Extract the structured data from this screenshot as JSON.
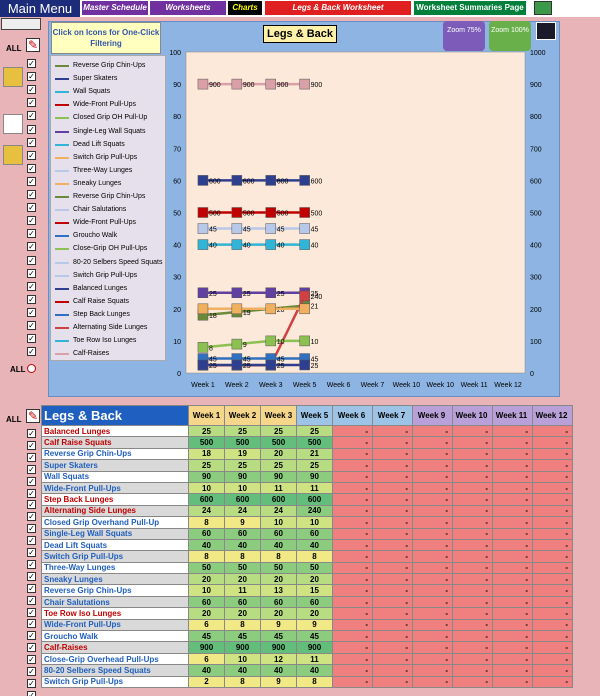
{
  "nav": {
    "main_menu": "Main Menu",
    "master_schedule": "Master Schedule",
    "worksheets": "Worksheets",
    "charts": "Charts",
    "legs_back_worksheet": "Legs & Back Worksheet",
    "worksheet_summaries": "Worksheet Summaries Page"
  },
  "side": {
    "all_top": "ALL",
    "all_bottom": "ALL",
    "all_table": "ALL"
  },
  "chart_panel": {
    "tip": "Click on Icons  for One-Click Filtering",
    "zoom75": "Zoom 75%",
    "zoom100": "Zoom 100%"
  },
  "chart_data": {
    "type": "line",
    "title": "Legs & Back",
    "categories": [
      "Week 1",
      "Week 2",
      "Week 3",
      "Week 5",
      "Week 6",
      "Week 7",
      "Week 10",
      "Week 10",
      "Week 11",
      "Week 12"
    ],
    "ylim": [
      0,
      100
    ],
    "y_ticks": [
      "0",
      "10",
      "20",
      "30",
      "40",
      "50",
      "60",
      "70",
      "80",
      "90",
      "100"
    ],
    "y2_ticks": [
      "0",
      "100",
      "200",
      "300",
      "400",
      "500",
      "600",
      "700",
      "800",
      "900",
      "1000"
    ],
    "legend": [
      "Reverse Grip Chin-Ups",
      "Super Skaters",
      "Wall Squats",
      "Wide-Front Pull-Ups",
      "Closed Grip OH Pull-Up",
      "Single-Leg Wall Squats",
      "Dead Lift Squats",
      "Switch Grip Pull-Ups",
      "Three-Way Lunges",
      "Sneaky Lunges",
      "Reverse Grip Chin-Ups",
      "Chair Salutations",
      "Wide-Front Pull-Ups",
      "Groucho Walk",
      "Close-Grip OH Pull-Ups",
      "80-20 Selbers Speed Squats",
      "Switch Grip Pull-Ups",
      "Balanced Lunges",
      "Calf Raise Squats",
      "Step Back Lunges",
      "Alternating Side Lunges",
      "Toe Row Iso Lunges",
      "Calf-Raises"
    ],
    "series": [
      {
        "name": "Calf-Raises",
        "values": [
          900,
          900,
          900,
          900
        ],
        "axis": "right",
        "color": "#d9a0a8",
        "labels": [
          "900",
          "900",
          "900",
          "900"
        ]
      },
      {
        "name": "Dead Lift Squats",
        "values": [
          600,
          600,
          600,
          600
        ],
        "axis": "right",
        "color": "#2e3f8f",
        "labels": [
          "600",
          "600",
          "600",
          "600"
        ]
      },
      {
        "name": "Calf Raise Squats",
        "values": [
          500,
          500,
          500,
          500
        ],
        "axis": "right",
        "color": "#c00000",
        "labels": [
          "500",
          "500",
          "500",
          "500"
        ]
      },
      {
        "name": "Three-Way Lunges",
        "values": [
          45,
          45,
          45,
          45
        ],
        "axis": "left",
        "color": "#b8c8e8",
        "labels": [
          "45",
          "45",
          "45",
          "45"
        ]
      },
      {
        "name": "Wall Squats",
        "values": [
          40,
          40,
          40,
          40
        ],
        "axis": "left",
        "color": "#31b4d6",
        "labels": [
          "40",
          "40",
          "40",
          "40"
        ]
      },
      {
        "name": "Single-Leg Wall Squats",
        "values": [
          25,
          25,
          25,
          25
        ],
        "axis": "left",
        "color": "#6040a0",
        "labels": [
          "25",
          "25",
          "25",
          "25"
        ]
      },
      {
        "name": "Reverse Grip Chin-Ups",
        "values": [
          18,
          19,
          20,
          21
        ],
        "axis": "left",
        "color": "#6a8a3a",
        "labels": [
          "18",
          "19",
          "20",
          "21"
        ]
      },
      {
        "name": "Alternating Side Lunges",
        "values": [
          2.4,
          2.4,
          2.4,
          24
        ],
        "axis": "left",
        "color": "#d04040",
        "labels": [
          "",
          "",
          "",
          "240"
        ]
      },
      {
        "name": "Groucho Walk",
        "values": [
          4.5,
          4.5,
          4.5,
          4.5
        ],
        "axis": "left",
        "color": "#3070c0",
        "labels": [
          "45",
          "45",
          "45",
          "45"
        ]
      },
      {
        "name": "Closed Grip OH Pull-Up",
        "values": [
          8,
          9,
          10,
          10
        ],
        "axis": "left",
        "color": "#8cc050",
        "labels": [
          "8",
          "9",
          "10",
          "10"
        ]
      },
      {
        "name": "Sneaky Lunges",
        "values": [
          20,
          20,
          20,
          20
        ],
        "axis": "left",
        "color": "#f0b060",
        "labels": [
          "",
          "",
          "",
          ""
        ]
      },
      {
        "name": "Balanced Lunges",
        "values": [
          2.5,
          2.5,
          2.5,
          2.5
        ],
        "axis": "left",
        "color": "#2e3f8f",
        "labels": [
          "25",
          "25",
          "25",
          "25"
        ]
      }
    ]
  },
  "table": {
    "title": "Legs & Back",
    "headers": [
      "Week 1",
      "Week 2",
      "Week 3",
      "Week 5",
      "Week 6",
      "Week 7",
      "Week 9",
      "Week 10",
      "Week 11",
      "Week 12"
    ],
    "rows": [
      {
        "name": "Balanced Lunges",
        "v": [
          "25",
          "25",
          "25",
          "25"
        ],
        "red": true
      },
      {
        "name": "Calf Raise Squats",
        "v": [
          "500",
          "500",
          "500",
          "500"
        ],
        "red": true
      },
      {
        "name": "Reverse Grip Chin-Ups",
        "v": [
          "18",
          "19",
          "20",
          "21"
        ],
        "red": false
      },
      {
        "name": "Super Skaters",
        "v": [
          "25",
          "25",
          "25",
          "25"
        ],
        "red": false
      },
      {
        "name": "Wall Squats",
        "v": [
          "90",
          "90",
          "90",
          "90"
        ],
        "red": false
      },
      {
        "name": "Wide-Front Pull-Ups",
        "v": [
          "10",
          "10",
          "11",
          "11"
        ],
        "red": false
      },
      {
        "name": "Step Back Lunges",
        "v": [
          "600",
          "600",
          "600",
          "600"
        ],
        "red": true
      },
      {
        "name": "Alternating Side Lunges",
        "v": [
          "24",
          "24",
          "24",
          "240"
        ],
        "red": true
      },
      {
        "name": "Closed Grip Overhand Pull-Up",
        "v": [
          "8",
          "9",
          "10",
          "10"
        ],
        "red": false
      },
      {
        "name": "Single-Leg Wall Squats",
        "v": [
          "60",
          "60",
          "60",
          "60"
        ],
        "red": false
      },
      {
        "name": "Dead Lift Squats",
        "v": [
          "40",
          "40",
          "40",
          "40"
        ],
        "red": false
      },
      {
        "name": "Switch Grip Pull-Ups",
        "v": [
          "8",
          "8",
          "8",
          "8"
        ],
        "red": false
      },
      {
        "name": "Three-Way Lunges",
        "v": [
          "50",
          "50",
          "50",
          "50"
        ],
        "red": false
      },
      {
        "name": "Sneaky Lunges",
        "v": [
          "20",
          "20",
          "20",
          "20"
        ],
        "red": false
      },
      {
        "name": "Reverse Grip Chin-Ups",
        "v": [
          "10",
          "11",
          "13",
          "15"
        ],
        "red": false
      },
      {
        "name": "Chair Salutations",
        "v": [
          "60",
          "60",
          "60",
          "60"
        ],
        "red": false
      },
      {
        "name": "Toe Row Iso Lunges",
        "v": [
          "20",
          "20",
          "20",
          "20"
        ],
        "red": true
      },
      {
        "name": "Wide-Front Pull-Ups",
        "v": [
          "6",
          "8",
          "9",
          "9"
        ],
        "red": false
      },
      {
        "name": "Groucho Walk",
        "v": [
          "45",
          "45",
          "45",
          "45"
        ],
        "red": false
      },
      {
        "name": "Calf-Raises",
        "v": [
          "900",
          "900",
          "900",
          "900"
        ],
        "red": true
      },
      {
        "name": "Close-Grip Overhead Pull-Ups",
        "v": [
          "6",
          "10",
          "12",
          "11"
        ],
        "red": false
      },
      {
        "name": "80-20 Selbers Speed Squats",
        "v": [
          "40",
          "40",
          "40",
          "40"
        ],
        "red": false
      },
      {
        "name": "Switch Grip Pull-Ups",
        "v": [
          "2",
          "8",
          "9",
          "8"
        ],
        "red": false
      }
    ],
    "dash": "-"
  },
  "colors": {
    "week1": "#f5d68a",
    "week2": "#f5d68a",
    "week3": "#f5d68a",
    "week5": "#9dc3e6",
    "week6": "#9dc3e6",
    "week7": "#9dc3e6",
    "week9": "#b9a0d8",
    "week10": "#b9a0d8",
    "week11": "#b9a0d8",
    "week12": "#b9a0d8",
    "plot_bg": "#fde9d9",
    "red_text": "#c00000",
    "blue_text": "#1f5fbf"
  }
}
